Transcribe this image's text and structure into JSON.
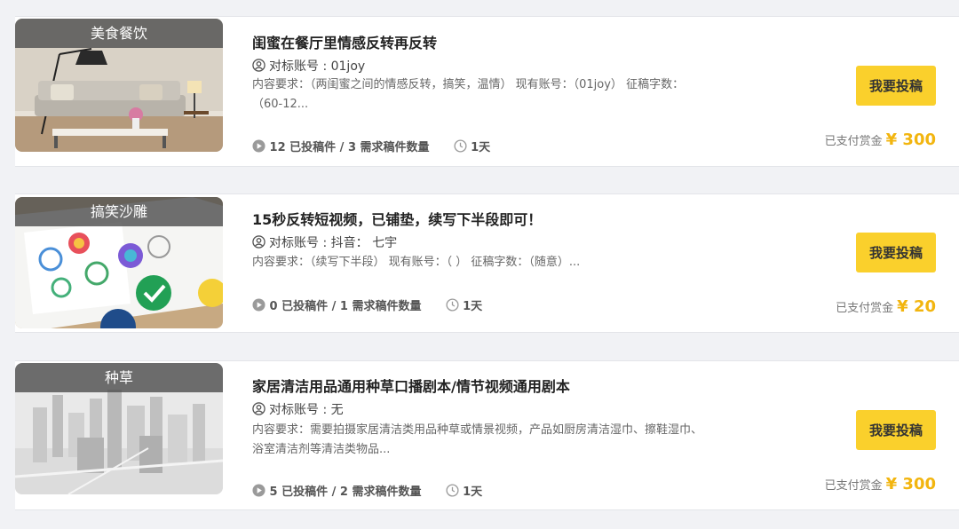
{
  "tasks": [
    {
      "category": "美食餐饮",
      "title": "闺蜜在餐厅里情感反转再反转",
      "account": "对标账号 : 01joy",
      "requirement": "内容要求：（两闺蜜之间的情感反转，搞笑，温情） 现有账号：（01joy） 征稿字数：（60-12...",
      "submitted": "12 已投稿件 / 3 需求稿件数量",
      "duration": "1天",
      "button": "我要投稿",
      "reward_label": "已支付赏金",
      "reward_amount": "¥ 300"
    },
    {
      "category": "搞笑沙雕",
      "title": "15秒反转短视频，已铺垫，续写下半段即可！",
      "account": "对标账号 : 抖音： 七宇",
      "requirement": "内容要求：（续写下半段） 现有账号：（ ） 征稿字数：（随意）...",
      "submitted": "0 已投稿件 / 1 需求稿件数量",
      "duration": "1天",
      "button": "我要投稿",
      "reward_label": "已支付赏金",
      "reward_amount": "¥ 20"
    },
    {
      "category": "种草",
      "title": "家居清洁用品通用种草口播剧本/情节视频通用剧本",
      "account": "对标账号 : 无",
      "requirement": "内容要求：需要拍摄家居清洁类用品种草或情景视频，产品如厨房清洁湿巾、擦鞋湿巾、浴室清洁剂等清洁类物品...",
      "submitted": "5 已投稿件 / 2 需求稿件数量",
      "duration": "1天",
      "button": "我要投稿",
      "reward_label": "已支付赏金",
      "reward_amount": "¥ 300"
    }
  ],
  "colors": {
    "accent_button": "#fad02c",
    "reward_text": "#f2b50f",
    "page_background": "#f1f2f5"
  },
  "icons": {
    "account": "user-circle-icon",
    "submitted": "play-circle-icon",
    "duration": "clock-icon"
  }
}
